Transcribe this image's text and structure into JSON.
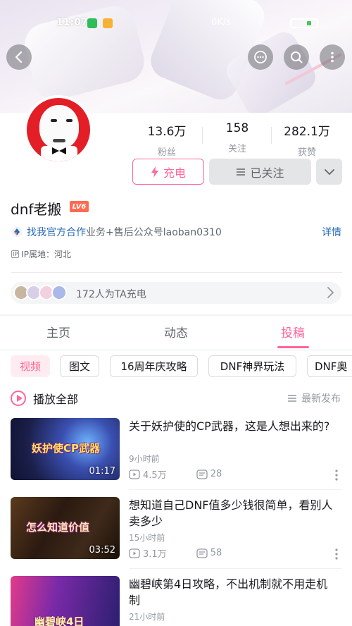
{
  "status_bar": {
    "time": "11:07",
    "net_speed": "0K/s"
  },
  "header": {
    "back_icon": "back-arrow-icon",
    "chat_icon": "chat-bubble-icon",
    "search_icon": "search-icon",
    "more_icon": "vertical-dots-icon"
  },
  "profile": {
    "stats": [
      {
        "value": "13.6万",
        "label": "粉丝"
      },
      {
        "value": "158",
        "label": "关注"
      },
      {
        "value": "282.1万",
        "label": "获赞"
      }
    ],
    "charge_label": "充电",
    "followed_label": "已关注",
    "username": "dnf老搬",
    "level": "LV6",
    "bio_link": "找我官方合作",
    "bio_text": "业务+售后公众号laoban0310",
    "bio_more": "详情",
    "ip_badge": "IP",
    "ip_location": "IP属地：河北",
    "charge_count_text": "172人为TA充电"
  },
  "tabs": [
    {
      "label": "主页"
    },
    {
      "label": "动态"
    },
    {
      "label": "投稿",
      "active": true
    }
  ],
  "chips": [
    "视频",
    "图文",
    "16周年庆攻略",
    "DNF神界玩法",
    "DNF奥"
  ],
  "list_header": {
    "play_all": "播放全部",
    "sort": "最新发布"
  },
  "videos": [
    {
      "title": "关于妖护使的CP武器，这是人想出来的?",
      "thumb_text": "妖护使CP武器",
      "duration": "01:17",
      "time": "9小时前",
      "views": "4.5万",
      "danmaku": "28"
    },
    {
      "title": "想知道自己DNF值多少钱很简单，看别人卖多少",
      "thumb_text": "怎么知道价值",
      "duration": "03:52",
      "time": "15小时前",
      "views": "3.1万",
      "danmaku": "58"
    },
    {
      "title": "幽碧峡第4日攻略，不出机制就不用走机制",
      "thumb_text": "幽碧峡4日",
      "time": "21小时前"
    }
  ],
  "colors": {
    "accent": "#ff6699",
    "link": "#2a6ab8",
    "avatar_bg": "#e31e26"
  }
}
